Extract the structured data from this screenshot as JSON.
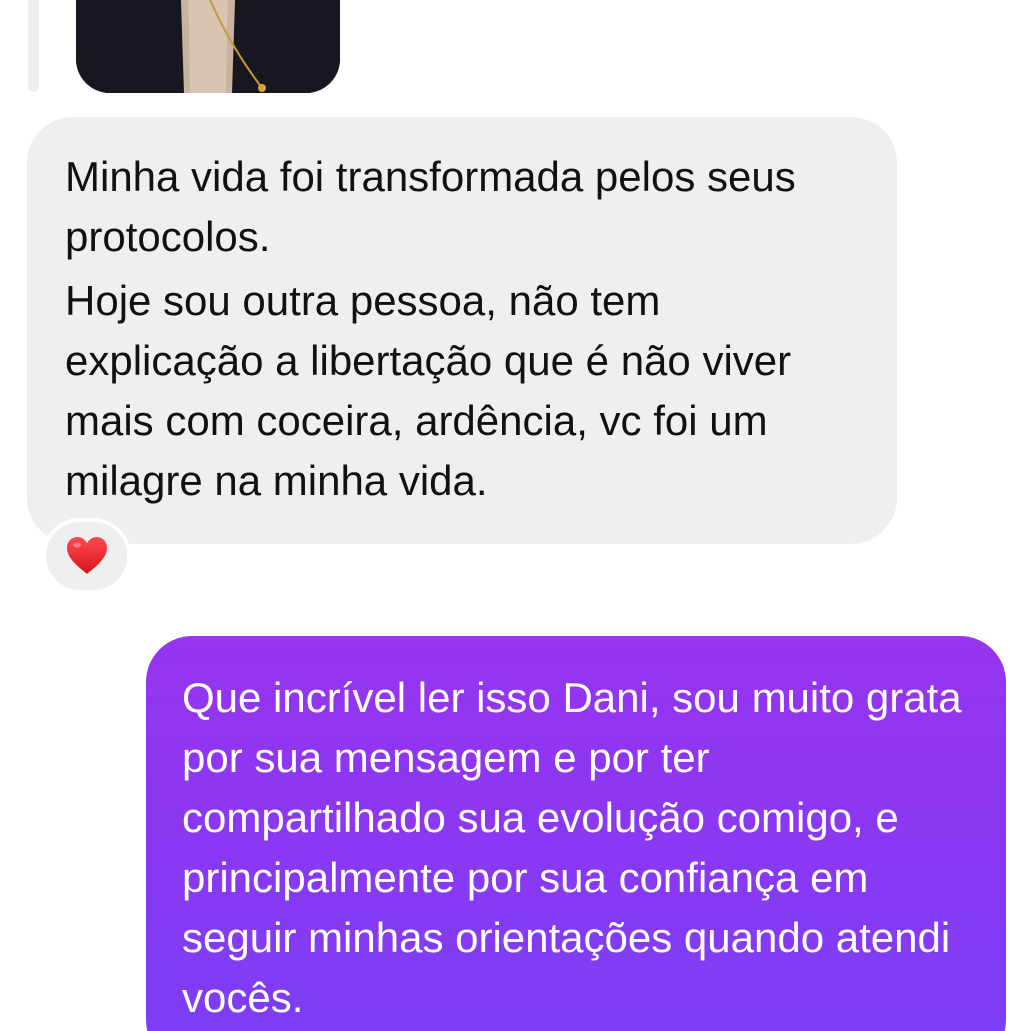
{
  "messages": [
    {
      "direction": "received",
      "paragraphs": [
        "Minha vida foi transformada pelos seus protocolos.",
        "Hoje sou outra pessoa, não tem explicação a libertação que é não viver mais com coceira, ardência, vc foi um milagre na minha vida."
      ],
      "reaction": {
        "icon": "red-heart-icon",
        "color": "#e0202a"
      }
    },
    {
      "direction": "sent",
      "paragraphs": [
        "Que incrível ler isso Dani, sou muito grata por sua mensagem e por ter compartilhado sua evolução comigo, e principalmente por sua confiança em seguir minhas orientações quando atendi vocês."
      ]
    }
  ],
  "colors": {
    "received_bubble": "#efeff2",
    "sent_bubble_top": "#9634f0",
    "sent_bubble_bottom": "#7a3ff5",
    "received_text": "#111111",
    "sent_text": "#ffffff"
  }
}
